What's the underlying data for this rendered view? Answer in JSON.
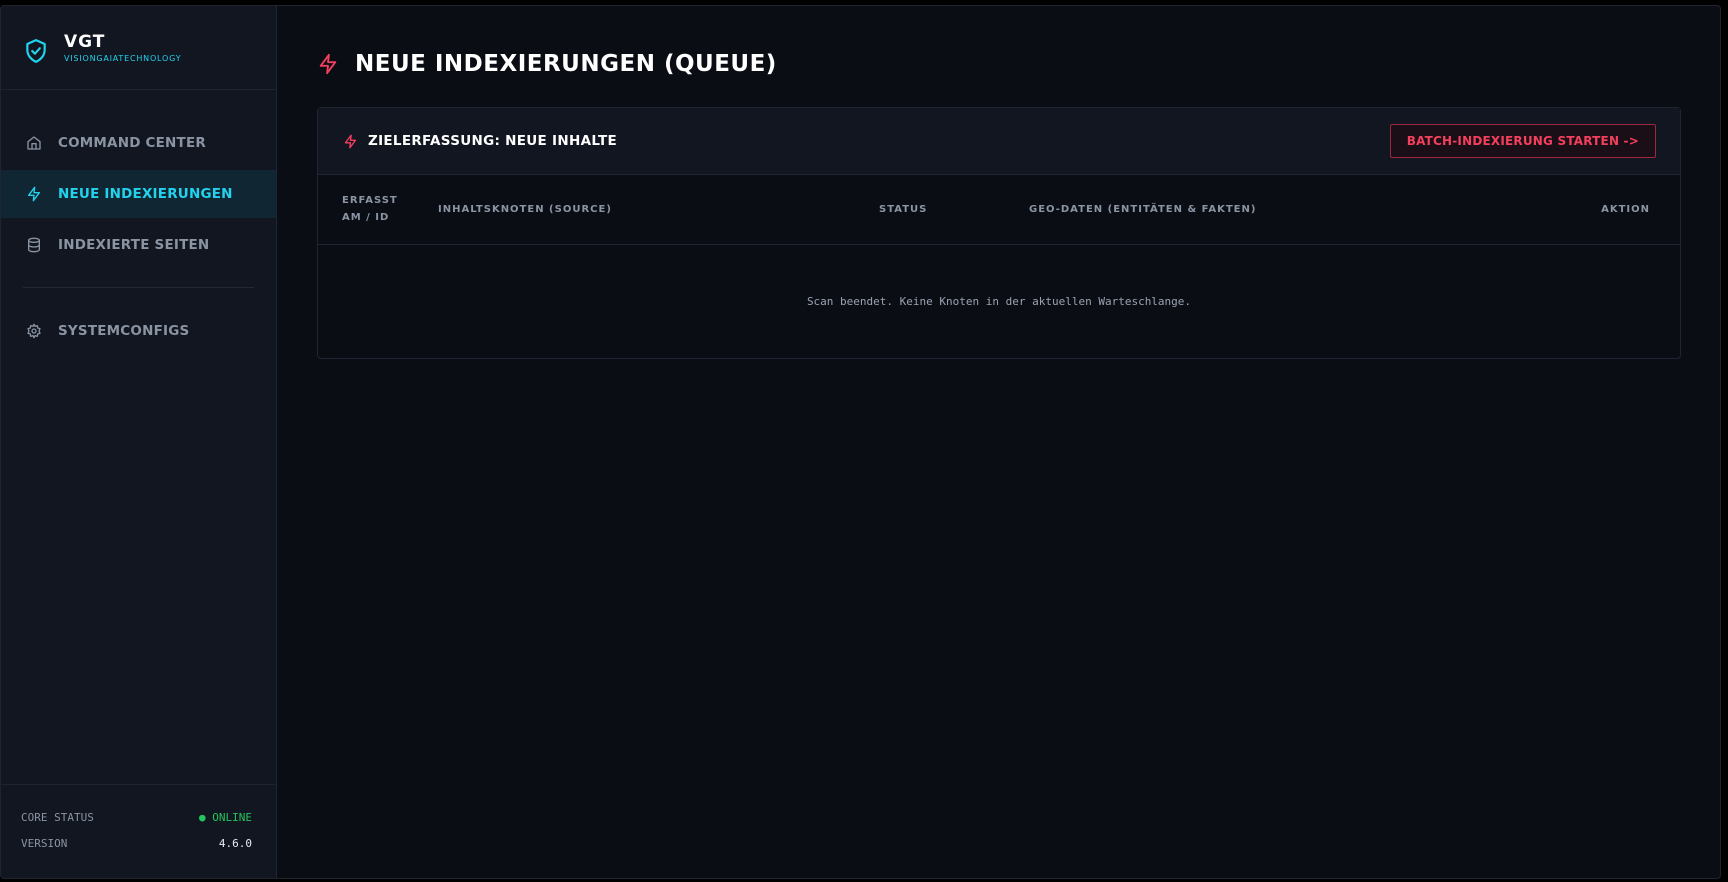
{
  "brand": {
    "title": "VGT",
    "subtitle": "VISIONGAIATECHNOLOGY",
    "icon": "shield-check-icon",
    "accent": "#22d3ee"
  },
  "sidebar": {
    "items": [
      {
        "label": "COMMAND CENTER",
        "icon": "home-icon",
        "active": false
      },
      {
        "label": "NEUE INDEXIERUNGEN",
        "icon": "lightning-icon",
        "active": true
      },
      {
        "label": "INDEXIERTE SEITEN",
        "icon": "database-icon",
        "active": false
      },
      {
        "label": "SYSTEMCONFIGS",
        "icon": "gear-icon",
        "active": false
      }
    ],
    "footer": {
      "core_status_label": "CORE STATUS",
      "core_status_value": "● ONLINE",
      "version_label": "VERSION",
      "version_value": "4.6.0"
    }
  },
  "main": {
    "title": "NEUE INDEXIERUNGEN (QUEUE)",
    "title_icon": "lightning-icon",
    "card": {
      "title": "ZIELERFASSUNG: NEUE INHALTE",
      "title_icon": "lightning-icon",
      "batch_button": "BATCH-INDEXIERUNG STARTEN ->",
      "columns": [
        "ERFASST AM / ID",
        "INHALTSKNOTEN (SOURCE)",
        "STATUS",
        "GEO-DATEN (ENTITÄTEN & FAKTEN)",
        "AKTION"
      ],
      "empty_message": "Scan beendet. Keine Knoten in der aktuellen Warteschlange."
    }
  },
  "colors": {
    "background": "#0a0d14",
    "sidebar": "#111620",
    "cyan_accent": "#22d3ee",
    "red_accent": "#f43f5e",
    "online": "#22c55e"
  }
}
